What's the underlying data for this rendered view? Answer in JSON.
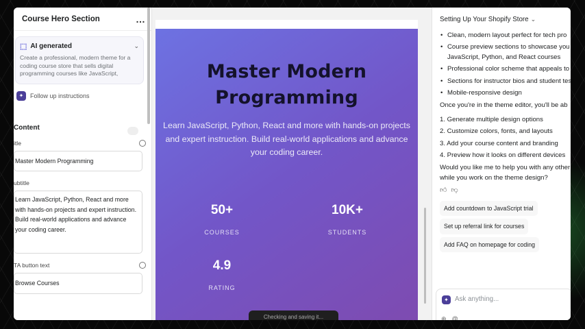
{
  "left_panel": {
    "title": "Course Hero Section",
    "menu_icon": "…",
    "ai_card": {
      "title": "AI generated",
      "description": "Create a professional, modern theme for a coding course store that sells digital programming courses like JavaScript,"
    },
    "follow_up": "Follow up instructions",
    "content_heading": "Content",
    "fields": {
      "title_label": "itle",
      "title_value": "Master Modern Programming",
      "subtitle_label": "ubtitle",
      "subtitle_value": "Learn JavaScript, Python, React and more with hands-on projects and expert instruction. Build real-world applications and advance your coding career.",
      "cta_label": "TA button text",
      "cta_value": "Browse Courses"
    }
  },
  "hero": {
    "title": "Master Modern Programming",
    "subtitle": "Learn JavaScript, Python, React and more with hands-on projects and expert instruction. Build real-world applications and advance your coding career.",
    "stats": [
      {
        "num": "50+",
        "label": "COURSES"
      },
      {
        "num": "10K+",
        "label": "STUDENTS"
      },
      {
        "num": "4.9",
        "label": "RATING"
      }
    ],
    "toast": "Checking and saving it..."
  },
  "chat": {
    "header": "Setting Up Your Shopify Store",
    "bullets": [
      "Clean, modern layout perfect for tech pro",
      "Course preview sections to showcase you JavaScript, Python, and React courses",
      "Professional color scheme that appeals to developers",
      "Sections for instructor bios and student testimonials",
      "Mobile-responsive design"
    ],
    "intro": "Once you're in the theme editor, you'll be ab",
    "steps": [
      "1. Generate multiple design options",
      "2. Customize colors, fonts, and layouts",
      "3. Add your course content and branding",
      "4. Preview how it looks on different devices"
    ],
    "question": "Would you like me to help you with any other tasks while you work on the theme design?",
    "suggestions": [
      "Add countdown to JavaScript trial",
      "Set up referral link for courses",
      "Add FAQ on homepage for coding"
    ],
    "input_placeholder": "Ask anything..."
  }
}
